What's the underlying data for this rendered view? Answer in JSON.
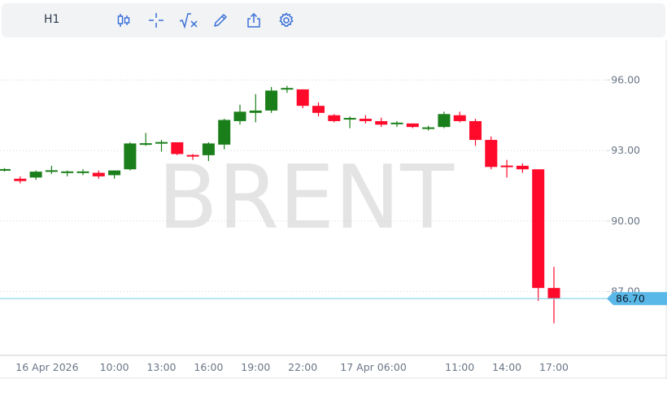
{
  "toolbar": {
    "timeframe": "H1",
    "icons": [
      "candles-icon",
      "crosshair-icon",
      "indicators-icon",
      "draw-icon",
      "share-icon",
      "settings-icon"
    ]
  },
  "watermark": "BRENT",
  "colors": {
    "bull": "#1a7f1a",
    "bear": "#ff0a2a",
    "price_line": "#7fd3ea",
    "price_tag": "#5ab8e8",
    "axis_text": "#6a7686",
    "grid": "#d0d6dc",
    "watermark": "#e4e4e4"
  },
  "chart_data": {
    "type": "candlestick",
    "ylim": [
      84.7,
      97.5
    ],
    "y_ticks": [
      "96.00",
      "93.00",
      "90.00",
      "87.00"
    ],
    "x_tick_labels": [
      "16 Apr 2026",
      "10:00",
      "13:00",
      "16:00",
      "19:00",
      "22:00",
      "17 Apr 06:00",
      "11:00",
      "14:00",
      "17:00"
    ],
    "x_tick_candle_index": [
      0.8,
      7,
      10,
      13,
      16,
      19,
      23.5,
      29,
      32,
      35
    ],
    "current_price": "86.70",
    "current_price_value": 86.7,
    "candles": [
      {
        "o": 92.15,
        "h": 92.25,
        "l": 92.1,
        "c": 92.2
      },
      {
        "o": 91.8,
        "h": 91.9,
        "l": 91.6,
        "c": 91.7
      },
      {
        "o": 91.85,
        "h": 92.15,
        "l": 91.75,
        "c": 92.1
      },
      {
        "o": 92.1,
        "h": 92.35,
        "l": 92.0,
        "c": 92.15
      },
      {
        "o": 92.05,
        "h": 92.15,
        "l": 91.9,
        "c": 92.1
      },
      {
        "o": 92.05,
        "h": 92.2,
        "l": 91.95,
        "c": 92.1
      },
      {
        "o": 92.05,
        "h": 92.15,
        "l": 91.8,
        "c": 91.9
      },
      {
        "o": 91.95,
        "h": 92.15,
        "l": 91.8,
        "c": 92.15
      },
      {
        "o": 92.2,
        "h": 93.35,
        "l": 92.15,
        "c": 93.3
      },
      {
        "o": 93.25,
        "h": 93.75,
        "l": 93.2,
        "c": 93.3
      },
      {
        "o": 93.3,
        "h": 93.45,
        "l": 92.95,
        "c": 93.35
      },
      {
        "o": 93.35,
        "h": 93.35,
        "l": 92.8,
        "c": 92.85
      },
      {
        "o": 92.8,
        "h": 92.85,
        "l": 92.6,
        "c": 92.75
      },
      {
        "o": 92.8,
        "h": 93.35,
        "l": 92.55,
        "c": 93.3
      },
      {
        "o": 93.25,
        "h": 94.35,
        "l": 93.05,
        "c": 94.3
      },
      {
        "o": 94.25,
        "h": 94.95,
        "l": 94.1,
        "c": 94.65
      },
      {
        "o": 94.6,
        "h": 95.4,
        "l": 94.2,
        "c": 94.7
      },
      {
        "o": 94.7,
        "h": 95.7,
        "l": 94.6,
        "c": 95.55
      },
      {
        "o": 95.6,
        "h": 95.75,
        "l": 95.45,
        "c": 95.65
      },
      {
        "o": 95.6,
        "h": 95.6,
        "l": 94.8,
        "c": 94.9
      },
      {
        "o": 94.9,
        "h": 95.05,
        "l": 94.45,
        "c": 94.6
      },
      {
        "o": 94.5,
        "h": 94.55,
        "l": 94.2,
        "c": 94.25
      },
      {
        "o": 94.35,
        "h": 94.45,
        "l": 93.95,
        "c": 94.35
      },
      {
        "o": 94.35,
        "h": 94.5,
        "l": 94.15,
        "c": 94.25
      },
      {
        "o": 94.25,
        "h": 94.4,
        "l": 94.0,
        "c": 94.1
      },
      {
        "o": 94.15,
        "h": 94.25,
        "l": 94.0,
        "c": 94.15
      },
      {
        "o": 94.15,
        "h": 94.15,
        "l": 93.95,
        "c": 94.0
      },
      {
        "o": 93.95,
        "h": 94.05,
        "l": 93.85,
        "c": 93.95
      },
      {
        "o": 94.0,
        "h": 94.65,
        "l": 93.95,
        "c": 94.55
      },
      {
        "o": 94.5,
        "h": 94.65,
        "l": 94.2,
        "c": 94.25
      },
      {
        "o": 94.25,
        "h": 94.35,
        "l": 93.2,
        "c": 93.45
      },
      {
        "o": 93.45,
        "h": 93.6,
        "l": 92.2,
        "c": 92.3
      },
      {
        "o": 92.35,
        "h": 92.6,
        "l": 91.85,
        "c": 92.3
      },
      {
        "o": 92.35,
        "h": 92.45,
        "l": 92.05,
        "c": 92.2
      },
      {
        "o": 92.2,
        "h": 92.2,
        "l": 86.6,
        "c": 87.15
      },
      {
        "o": 87.15,
        "h": 88.05,
        "l": 85.65,
        "c": 86.7
      }
    ]
  }
}
